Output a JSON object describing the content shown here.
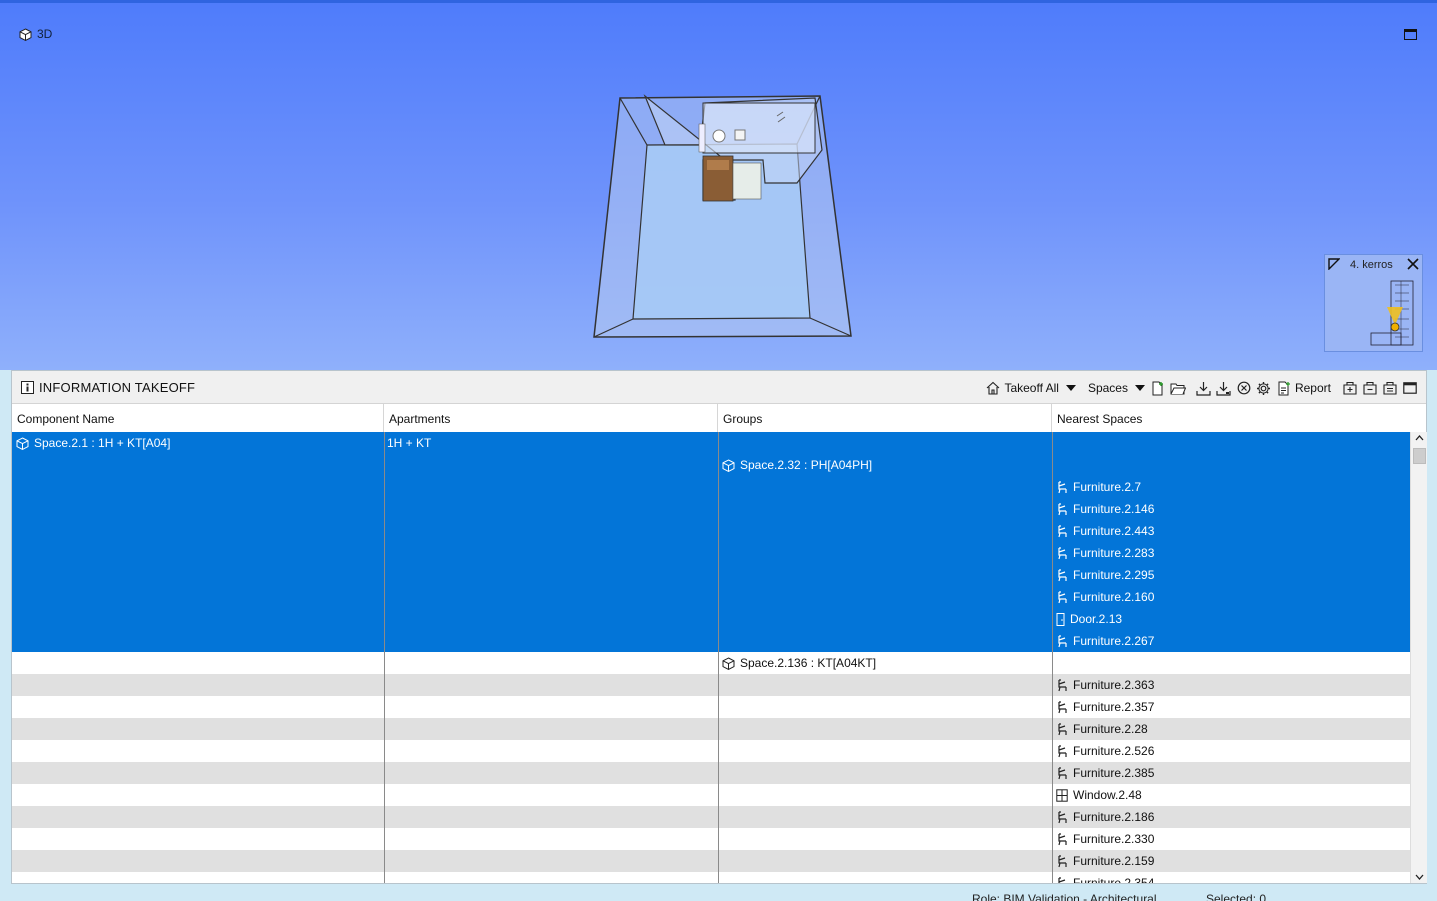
{
  "viewport": {
    "title": "3D",
    "minimap": {
      "title": "4. kerros"
    }
  },
  "panel": {
    "title": "INFORMATION TAKEOFF",
    "toolbar": {
      "takeoff_all": "Takeoff All",
      "spaces": "Spaces",
      "report": "Report"
    }
  },
  "table": {
    "columns": [
      "Component Name",
      "Apartments",
      "Groups",
      "Nearest Spaces"
    ],
    "rows": [
      {
        "component": "Space.2.1 : 1H + KT[A04]",
        "apartment": "1H + KT",
        "group": "",
        "nearest": "",
        "nearest_icon": "",
        "style": "selected"
      },
      {
        "component": "",
        "apartment": "",
        "group": "Space.2.32 : PH[A04PH]",
        "nearest": "",
        "nearest_icon": "",
        "style": "selected"
      },
      {
        "component": "",
        "apartment": "",
        "group": "",
        "nearest": "Furniture.2.7",
        "nearest_icon": "furniture-icon",
        "style": "selected"
      },
      {
        "component": "",
        "apartment": "",
        "group": "",
        "nearest": "Furniture.2.146",
        "nearest_icon": "furniture-icon",
        "style": "selected"
      },
      {
        "component": "",
        "apartment": "",
        "group": "",
        "nearest": "Furniture.2.443",
        "nearest_icon": "furniture-icon",
        "style": "selected"
      },
      {
        "component": "",
        "apartment": "",
        "group": "",
        "nearest": "Furniture.2.283",
        "nearest_icon": "furniture-icon",
        "style": "selected"
      },
      {
        "component": "",
        "apartment": "",
        "group": "",
        "nearest": "Furniture.2.295",
        "nearest_icon": "furniture-icon",
        "style": "selected"
      },
      {
        "component": "",
        "apartment": "",
        "group": "",
        "nearest": "Furniture.2.160",
        "nearest_icon": "furniture-icon",
        "style": "selected"
      },
      {
        "component": "",
        "apartment": "",
        "group": "",
        "nearest": "Door.2.13",
        "nearest_icon": "door-icon",
        "style": "selected"
      },
      {
        "component": "",
        "apartment": "",
        "group": "",
        "nearest": "Furniture.2.267",
        "nearest_icon": "furniture-icon",
        "style": "selected"
      },
      {
        "component": "",
        "apartment": "",
        "group": "Space.2.136 : KT[A04KT]",
        "nearest": "",
        "nearest_icon": "",
        "style": "white"
      },
      {
        "component": "",
        "apartment": "",
        "group": "",
        "nearest": "Furniture.2.363",
        "nearest_icon": "furniture-icon",
        "style": "alt"
      },
      {
        "component": "",
        "apartment": "",
        "group": "",
        "nearest": "Furniture.2.357",
        "nearest_icon": "furniture-icon",
        "style": "white"
      },
      {
        "component": "",
        "apartment": "",
        "group": "",
        "nearest": "Furniture.2.28",
        "nearest_icon": "furniture-icon",
        "style": "alt"
      },
      {
        "component": "",
        "apartment": "",
        "group": "",
        "nearest": "Furniture.2.526",
        "nearest_icon": "furniture-icon",
        "style": "white"
      },
      {
        "component": "",
        "apartment": "",
        "group": "",
        "nearest": "Furniture.2.385",
        "nearest_icon": "furniture-icon",
        "style": "alt"
      },
      {
        "component": "",
        "apartment": "",
        "group": "",
        "nearest": "Window.2.48",
        "nearest_icon": "window-icon",
        "style": "white"
      },
      {
        "component": "",
        "apartment": "",
        "group": "",
        "nearest": "Furniture.2.186",
        "nearest_icon": "furniture-icon",
        "style": "alt"
      },
      {
        "component": "",
        "apartment": "",
        "group": "",
        "nearest": "Furniture.2.330",
        "nearest_icon": "furniture-icon",
        "style": "white"
      },
      {
        "component": "",
        "apartment": "",
        "group": "",
        "nearest": "Furniture.2.159",
        "nearest_icon": "furniture-icon",
        "style": "alt"
      },
      {
        "component": "",
        "apartment": "",
        "group": "",
        "nearest": "Furniture.2.354",
        "nearest_icon": "furniture-icon",
        "style": "white"
      }
    ]
  },
  "statusbar": {
    "role": "Role: BIM Validation - Architectural",
    "selected": "Selected: 0"
  },
  "colors": {
    "selection": "#0375d8",
    "viewport_top": "#4f7cfb",
    "viewport_bottom": "#8fb0fb",
    "row_alt": "#e0e0e0"
  }
}
